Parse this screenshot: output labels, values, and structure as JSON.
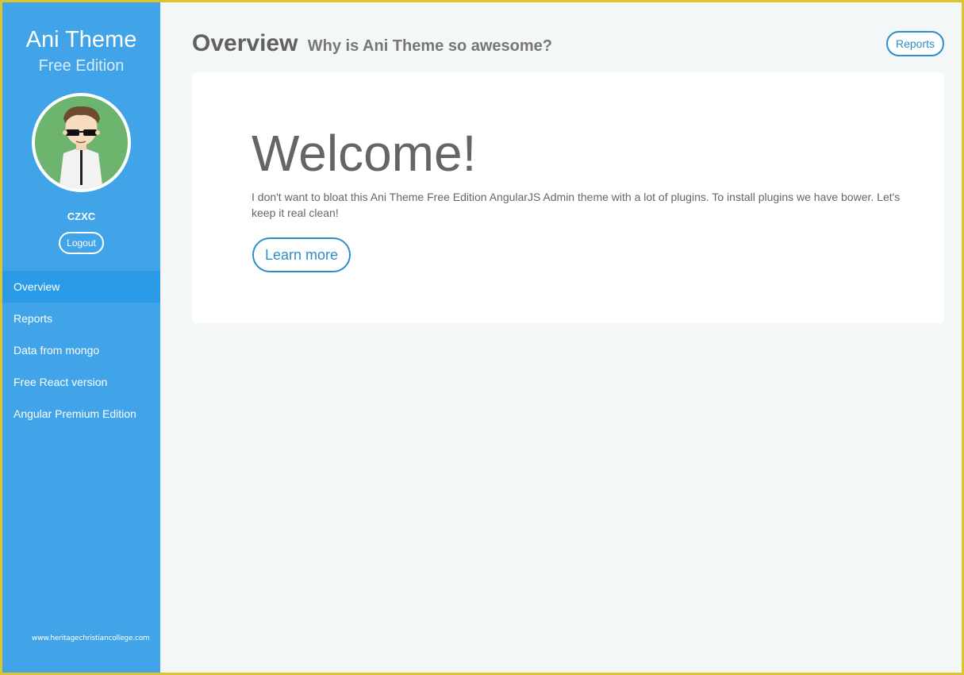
{
  "brand": {
    "title": "Ani Theme",
    "subtitle": "Free Edition"
  },
  "user": {
    "name": "CZXC",
    "logout_label": "Logout"
  },
  "nav": {
    "items": [
      {
        "label": "Overview",
        "active": true
      },
      {
        "label": "Reports",
        "active": false
      },
      {
        "label": "Data from mongo",
        "active": false
      },
      {
        "label": "Free React version",
        "active": false
      },
      {
        "label": "Angular Premium Edition",
        "active": false
      }
    ]
  },
  "footer": {
    "url": "www.heritagechristiancollege.com"
  },
  "header": {
    "title": "Overview",
    "subtitle": "Why is Ani Theme so awesome?",
    "reports_label": "Reports"
  },
  "hero": {
    "heading": "Welcome!",
    "text": "I don't want to bloat this Ani Theme Free Edition AngularJS Admin theme with a lot of plugins. To install plugins we have bower. Let's keep it real clean!",
    "button_label": "Learn more"
  },
  "colors": {
    "sidebar": "#41a3e8",
    "sidebar_active": "#2b9be7",
    "accent": "#2b8ec9",
    "background": "#f4f7f8",
    "frame": "#dcc42e"
  },
  "icons": {
    "avatar": "avatar-cartoon-icon"
  }
}
